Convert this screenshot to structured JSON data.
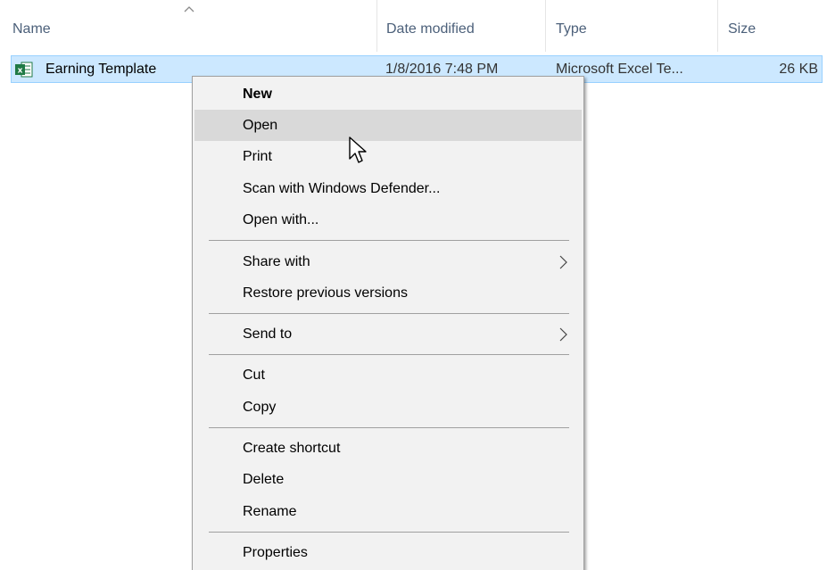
{
  "columns": {
    "name": "Name",
    "date_modified": "Date modified",
    "type": "Type",
    "size": "Size"
  },
  "file": {
    "name": "Earning Template",
    "date_modified": "1/8/2016 7:48 PM",
    "type": "Microsoft Excel Te...",
    "size": "26 KB",
    "icon": "excel-file-icon"
  },
  "context_menu": {
    "items": [
      {
        "label": "New",
        "bold": true
      },
      {
        "label": "Open",
        "highlighted": true
      },
      {
        "label": "Print"
      },
      {
        "label": "Scan with Windows Defender..."
      },
      {
        "label": "Open with..."
      },
      {
        "label": "Share with",
        "submenu": true
      },
      {
        "label": "Restore previous versions"
      },
      {
        "label": "Send to",
        "submenu": true
      },
      {
        "label": "Cut"
      },
      {
        "label": "Copy"
      },
      {
        "label": "Create shortcut"
      },
      {
        "label": "Delete"
      },
      {
        "label": "Rename"
      },
      {
        "label": "Properties"
      }
    ]
  },
  "colors": {
    "selection_bg": "#cce8ff",
    "selection_border": "#99d1ff",
    "menu_bg": "#f2f2f2",
    "menu_hover": "#d9d9d9",
    "header_text": "#4c607a",
    "excel_green": "#1f7a45"
  }
}
